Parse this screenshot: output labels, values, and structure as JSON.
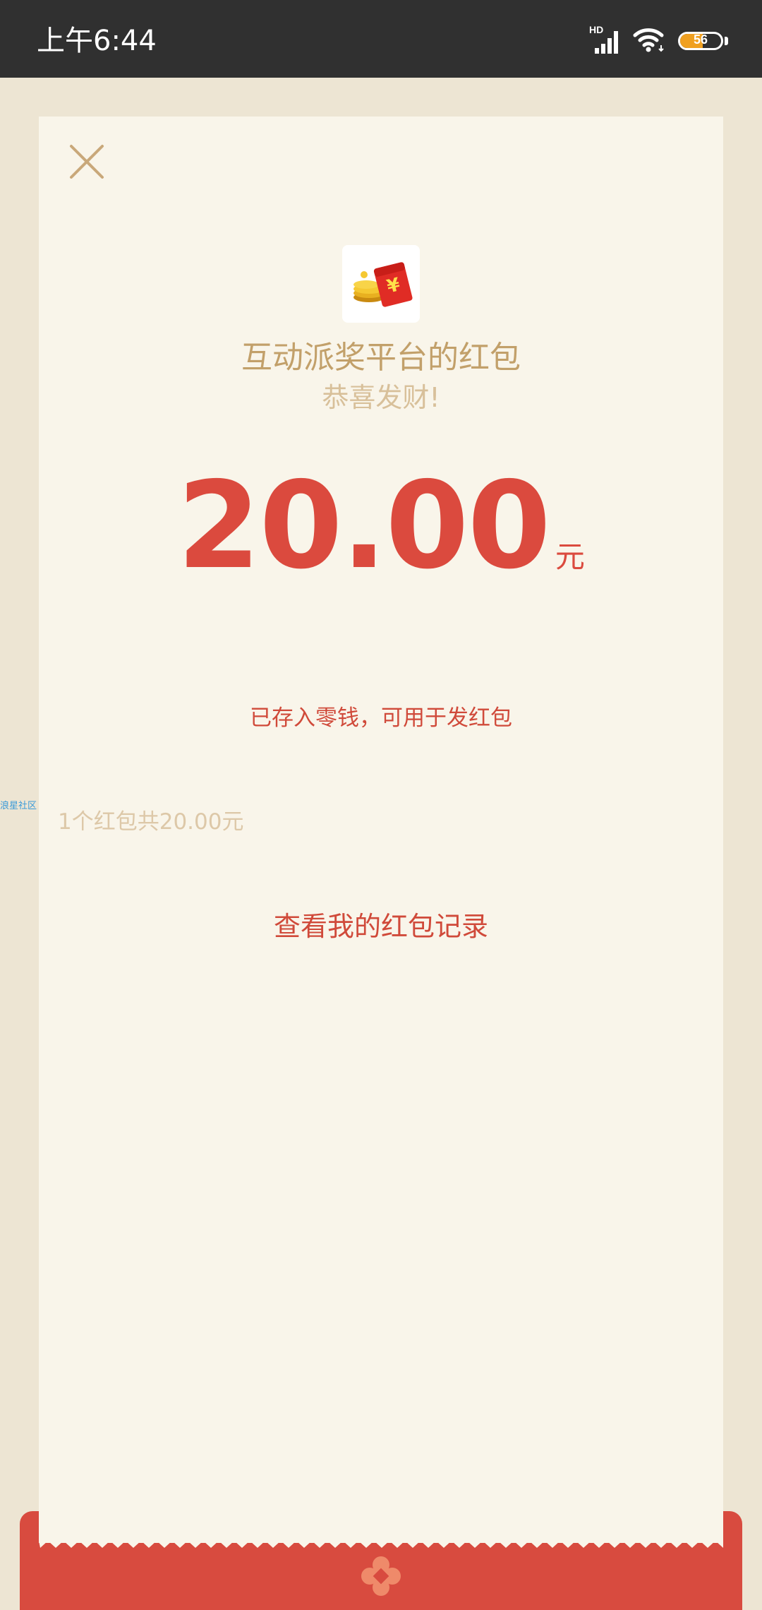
{
  "status_bar": {
    "time": "上午6:44",
    "network_label": "HD",
    "battery_percent": "56",
    "battery_level": 0.56,
    "battery_color": "#f0a020"
  },
  "side_watermark": "浪星社区",
  "envelope": {
    "title": "互动派奖平台的红包",
    "greeting": "恭喜发财!",
    "amount": "20.00",
    "unit": "元",
    "saved_note": "已存入零钱，可用于发红包",
    "summary": "1个红包共20.00元",
    "record_link": "查看我的红包记录"
  },
  "icons": {
    "close": "close-icon",
    "logo": "red-envelope-coins-icon",
    "signal": "signal-icon",
    "wifi": "wifi-icon",
    "battery": "battery-icon",
    "ornament": "flower-ornament-icon"
  },
  "colors": {
    "accent_red": "#db4a3e",
    "gold_text": "#c2a06a",
    "card_background": "#f9f5ea",
    "page_background": "#ede5d3",
    "status_bar": "#303030"
  }
}
